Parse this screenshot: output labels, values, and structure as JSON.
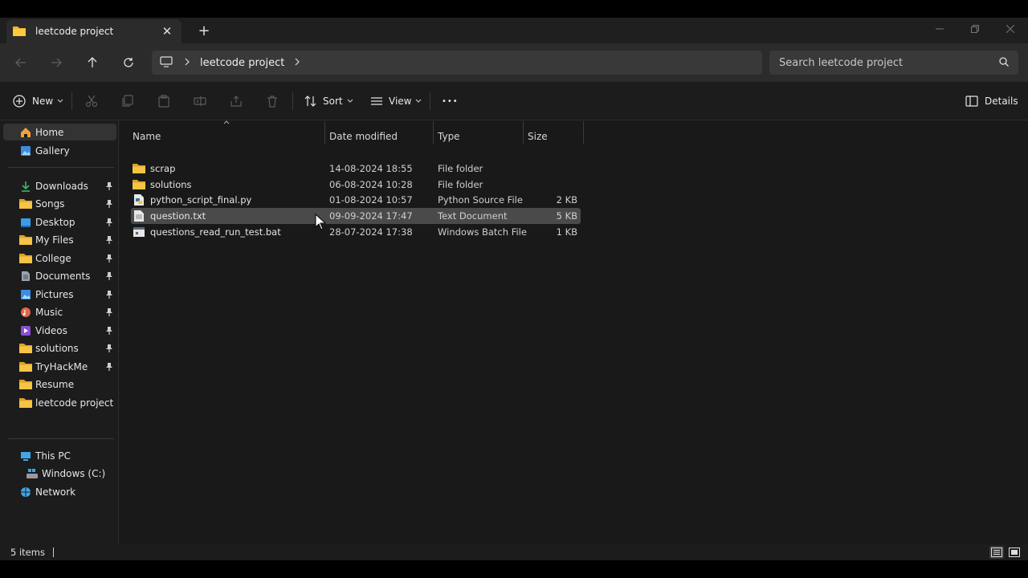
{
  "tab": {
    "title": "leetcode project",
    "close": "✕",
    "new": "+"
  },
  "address": {
    "segment": "leetcode project"
  },
  "search": {
    "placeholder": "Search leetcode project"
  },
  "toolbar": {
    "new_label": "New",
    "sort_label": "Sort",
    "view_label": "View",
    "more_label": "•••",
    "details_label": "Details"
  },
  "sidebar": {
    "home": "Home",
    "gallery": "Gallery",
    "quick": [
      {
        "label": "Downloads",
        "icon": "download-icon"
      },
      {
        "label": "Songs",
        "icon": "folder-icon"
      },
      {
        "label": "Desktop",
        "icon": "desktop-icon"
      },
      {
        "label": "My Files",
        "icon": "folder-icon"
      },
      {
        "label": "College",
        "icon": "folder-icon"
      },
      {
        "label": "Documents",
        "icon": "documents-icon"
      },
      {
        "label": "Pictures",
        "icon": "pictures-icon"
      },
      {
        "label": "Music",
        "icon": "music-icon"
      },
      {
        "label": "Videos",
        "icon": "videos-icon"
      },
      {
        "label": "solutions",
        "icon": "folder-icon"
      },
      {
        "label": "TryHackMe",
        "icon": "folder-icon"
      },
      {
        "label": "Resume",
        "icon": "folder-icon"
      },
      {
        "label": "leetcode project",
        "icon": "folder-icon"
      }
    ],
    "this_pc": "This PC",
    "windows_c": "Windows (C:)",
    "network": "Network"
  },
  "columns": {
    "name": "Name",
    "date": "Date modified",
    "type": "Type",
    "size": "Size"
  },
  "files": [
    {
      "name": "scrap",
      "date": "14-08-2024 18:55",
      "type": "File folder",
      "size": "",
      "icon": "folder-icon"
    },
    {
      "name": "solutions",
      "date": "06-08-2024 10:28",
      "type": "File folder",
      "size": "",
      "icon": "folder-icon"
    },
    {
      "name": "python_script_final.py",
      "date": "01-08-2024 10:57",
      "type": "Python Source File",
      "size": "2 KB",
      "icon": "python-file-icon"
    },
    {
      "name": "question.txt",
      "date": "09-09-2024 17:47",
      "type": "Text Document",
      "size": "5 KB",
      "icon": "text-file-icon"
    },
    {
      "name": "questions_read_run_test.bat",
      "date": "28-07-2024 17:38",
      "type": "Windows Batch File",
      "size": "1 KB",
      "icon": "batch-file-icon"
    }
  ],
  "status": {
    "count": "5 items"
  },
  "colors": {
    "folder": "#f0b429",
    "accent": "#4aa3f0",
    "selected_row": "#4a4a4a"
  }
}
